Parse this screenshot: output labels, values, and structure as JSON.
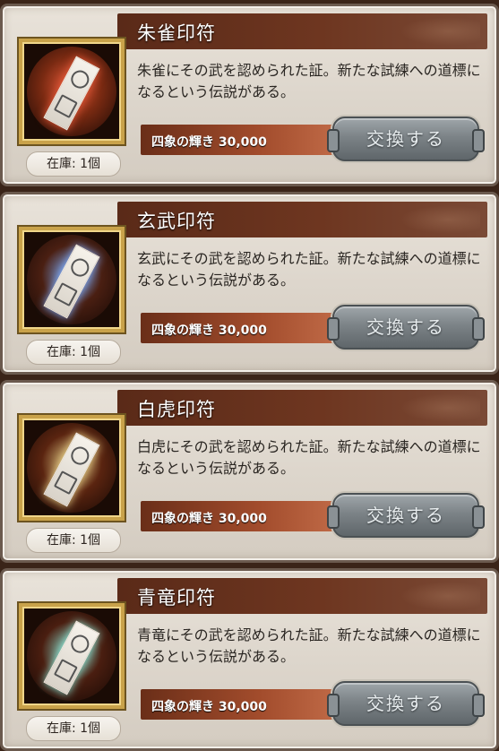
{
  "items": [
    {
      "title": "朱雀印符",
      "description": "朱雀にその武を認められた証。新たな試練への道標になるという伝説がある。",
      "cost": "四象の輝き 30,000",
      "stock": "在庫: 1個",
      "button": "交換する",
      "orb_color": "#7a2a12",
      "glow_color": "#e85a3a"
    },
    {
      "title": "玄武印符",
      "description": "玄武にその武を認められた証。新たな試練への道標になるという伝説がある。",
      "cost": "四象の輝き 30,000",
      "stock": "在庫: 1個",
      "button": "交換する",
      "orb_color": "#4a1f12",
      "glow_color": "#7fb0ff"
    },
    {
      "title": "白虎印符",
      "description": "白虎にその武を認められた証。新たな試練への道標になるという伝説がある。",
      "cost": "四象の輝き 30,000",
      "stock": "在庫: 1個",
      "button": "交換する",
      "orb_color": "#5a2410",
      "glow_color": "#e8d28a"
    },
    {
      "title": "青竜印符",
      "description": "青竜にその武を認められた証。新たな試練への道標になるという伝説がある。",
      "cost": "四象の輝き 30,000",
      "stock": "在庫: 1個",
      "button": "交換する",
      "orb_color": "#4a1e10",
      "glow_color": "#8fe8d8"
    }
  ]
}
